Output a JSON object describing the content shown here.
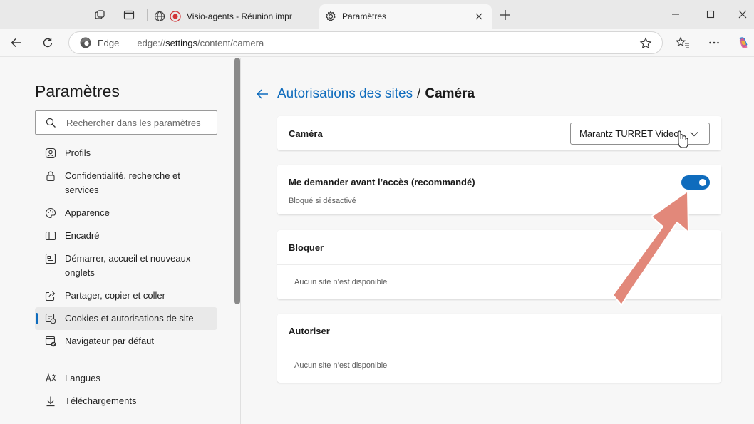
{
  "browser": {
    "tabs": [
      {
        "title": "Visio-agents - Réunion impr",
        "favicon": "recording-dot-icon",
        "active": false
      },
      {
        "title": "Paramètres",
        "favicon": "gear-icon",
        "active": true
      }
    ],
    "address": {
      "identity_label": "Edge",
      "url_prefix": "edge://",
      "url_host": "settings",
      "url_path": "/content/camera"
    }
  },
  "sidebar": {
    "title": "Paramètres",
    "search_placeholder": "Rechercher dans les paramètres",
    "items": [
      {
        "label": "Profils",
        "icon": "profile-icon",
        "active": false
      },
      {
        "label": "Confidentialité, recherche et services",
        "icon": "lock-icon",
        "active": false
      },
      {
        "label": "Apparence",
        "icon": "palette-icon",
        "active": false
      },
      {
        "label": "Encadré",
        "icon": "sidebar-panel-icon",
        "active": false
      },
      {
        "label": "Démarrer, accueil et nouveaux onglets",
        "icon": "home-tabs-icon",
        "active": false
      },
      {
        "label": "Partager, copier et coller",
        "icon": "share-icon",
        "active": false
      },
      {
        "label": "Cookies et autorisations de site",
        "icon": "cookie-settings-icon",
        "active": true
      },
      {
        "label": "Navigateur par défaut",
        "icon": "default-browser-icon",
        "active": false
      },
      {
        "label": "Langues",
        "icon": "language-icon",
        "active": false
      },
      {
        "label": "Téléchargements",
        "icon": "download-icon",
        "active": false
      }
    ]
  },
  "main": {
    "breadcrumb_parent": "Autorisations des sites",
    "breadcrumb_separator": "/",
    "breadcrumb_current": "Caméra",
    "camera": {
      "label": "Caméra",
      "selected_device": "Marantz TURRET Video"
    },
    "ask": {
      "label": "Me demander avant l’accès (recommandé)",
      "sublabel": "Bloqué si désactivé",
      "enabled": true
    },
    "block": {
      "label": "Bloquer",
      "empty": "Aucun site n’est disponible"
    },
    "allow": {
      "label": "Autoriser",
      "empty": "Aucun site n’est disponible"
    }
  },
  "colors": {
    "accent": "#0f6cbd",
    "annotation_arrow": "#e2887a"
  }
}
